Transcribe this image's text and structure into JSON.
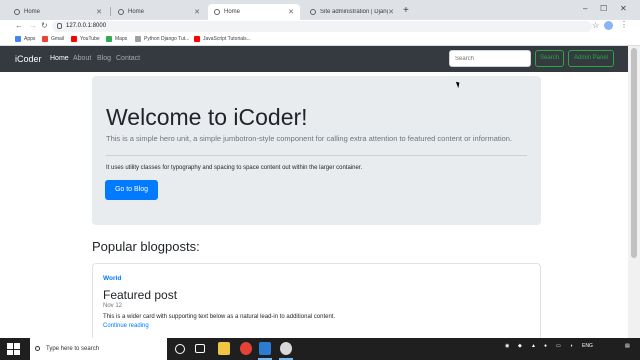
{
  "browser": {
    "tabs": [
      {
        "title": "Home",
        "active": false
      },
      {
        "title": "Home",
        "active": false
      },
      {
        "title": "Home",
        "active": true
      },
      {
        "title": "Site administration | Django site",
        "active": false
      }
    ],
    "url": "127.0.0.1:8000",
    "bookmarks": [
      {
        "label": "Apps",
        "icon": "apps-grid-icon",
        "color": "#4285f4"
      },
      {
        "label": "Gmail",
        "icon": "gmail-icon",
        "color": "#ea4335"
      },
      {
        "label": "YouTube",
        "icon": "youtube-icon",
        "color": "#ff0000"
      },
      {
        "label": "Maps",
        "icon": "maps-icon",
        "color": "#34a853"
      },
      {
        "label": "Python Django Tut...",
        "icon": "doc-icon",
        "color": "#9aa0a6"
      },
      {
        "label": "JavaScript Tutorials...",
        "icon": "youtube-icon",
        "color": "#ff0000"
      }
    ]
  },
  "site": {
    "brand": "iCoder",
    "nav": [
      {
        "label": "Home",
        "active": true
      },
      {
        "label": "About",
        "active": false
      },
      {
        "label": "Blog",
        "active": false
      },
      {
        "label": "Contact",
        "active": false
      }
    ],
    "search_placeholder": "Search",
    "search_button": "Search",
    "admin_button": "Admin Panel",
    "colors": {
      "navbar": "#343a40",
      "primary": "#007bff",
      "success": "#28a745",
      "jumbotron": "#e9ecef"
    }
  },
  "jumbotron": {
    "heading": "Welcome to iCoder!",
    "lead": "This is a simple hero unit, a simple jumbotron-style component for calling extra attention to featured content or information.",
    "text": "It uses utility classes for typography and spacing to space content out within the larger container.",
    "button": "Go to Blog"
  },
  "popular": {
    "heading": "Popular blogposts:",
    "card": {
      "category": "World",
      "title": "Featured post",
      "date": "Nov 12",
      "text": "This is a wider card with supporting text below as a natural lead-in to additional content.",
      "link": "Continue reading"
    }
  },
  "taskbar": {
    "search_placeholder": "Type here to search",
    "language": "ENG"
  }
}
